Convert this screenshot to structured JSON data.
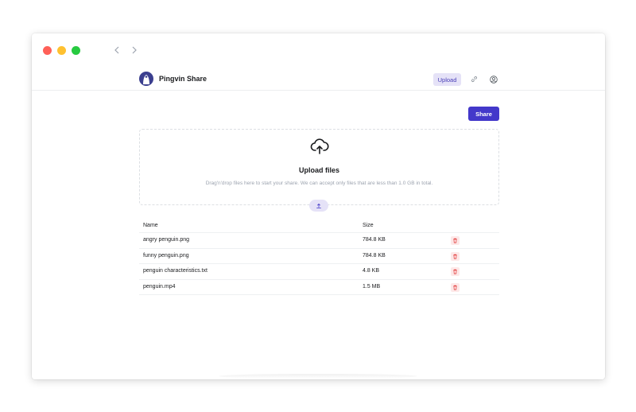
{
  "header": {
    "brand": "Pingvin Share",
    "upload_label": "Upload"
  },
  "toolbar": {
    "share_label": "Share"
  },
  "dropzone": {
    "title": "Upload files",
    "description": "Drag'n'drop files here to start your share. We can accept only files that are less than 1.0 GB in total."
  },
  "table": {
    "columns": {
      "name": "Name",
      "size": "Size"
    },
    "rows": [
      {
        "name": "angry penguin.png",
        "size": "784.8 KB"
      },
      {
        "name": "funny penguin.png",
        "size": "784.8 KB"
      },
      {
        "name": "penguin characteristics.txt",
        "size": "4.8 KB"
      },
      {
        "name": "penguin.mp4",
        "size": "1.5 MB"
      }
    ]
  },
  "colors": {
    "accent": "#4338ca",
    "accent_light": "#e5e2f7",
    "danger": "#e03131",
    "danger_light": "#fde8e8"
  },
  "icons": {
    "cloud_upload": "cloud-upload-icon",
    "link": "link-icon",
    "user": "user-circle-icon",
    "trash": "trash-icon",
    "back": "chevron-left-icon",
    "forward": "chevron-right-icon",
    "upload": "upload-icon"
  }
}
